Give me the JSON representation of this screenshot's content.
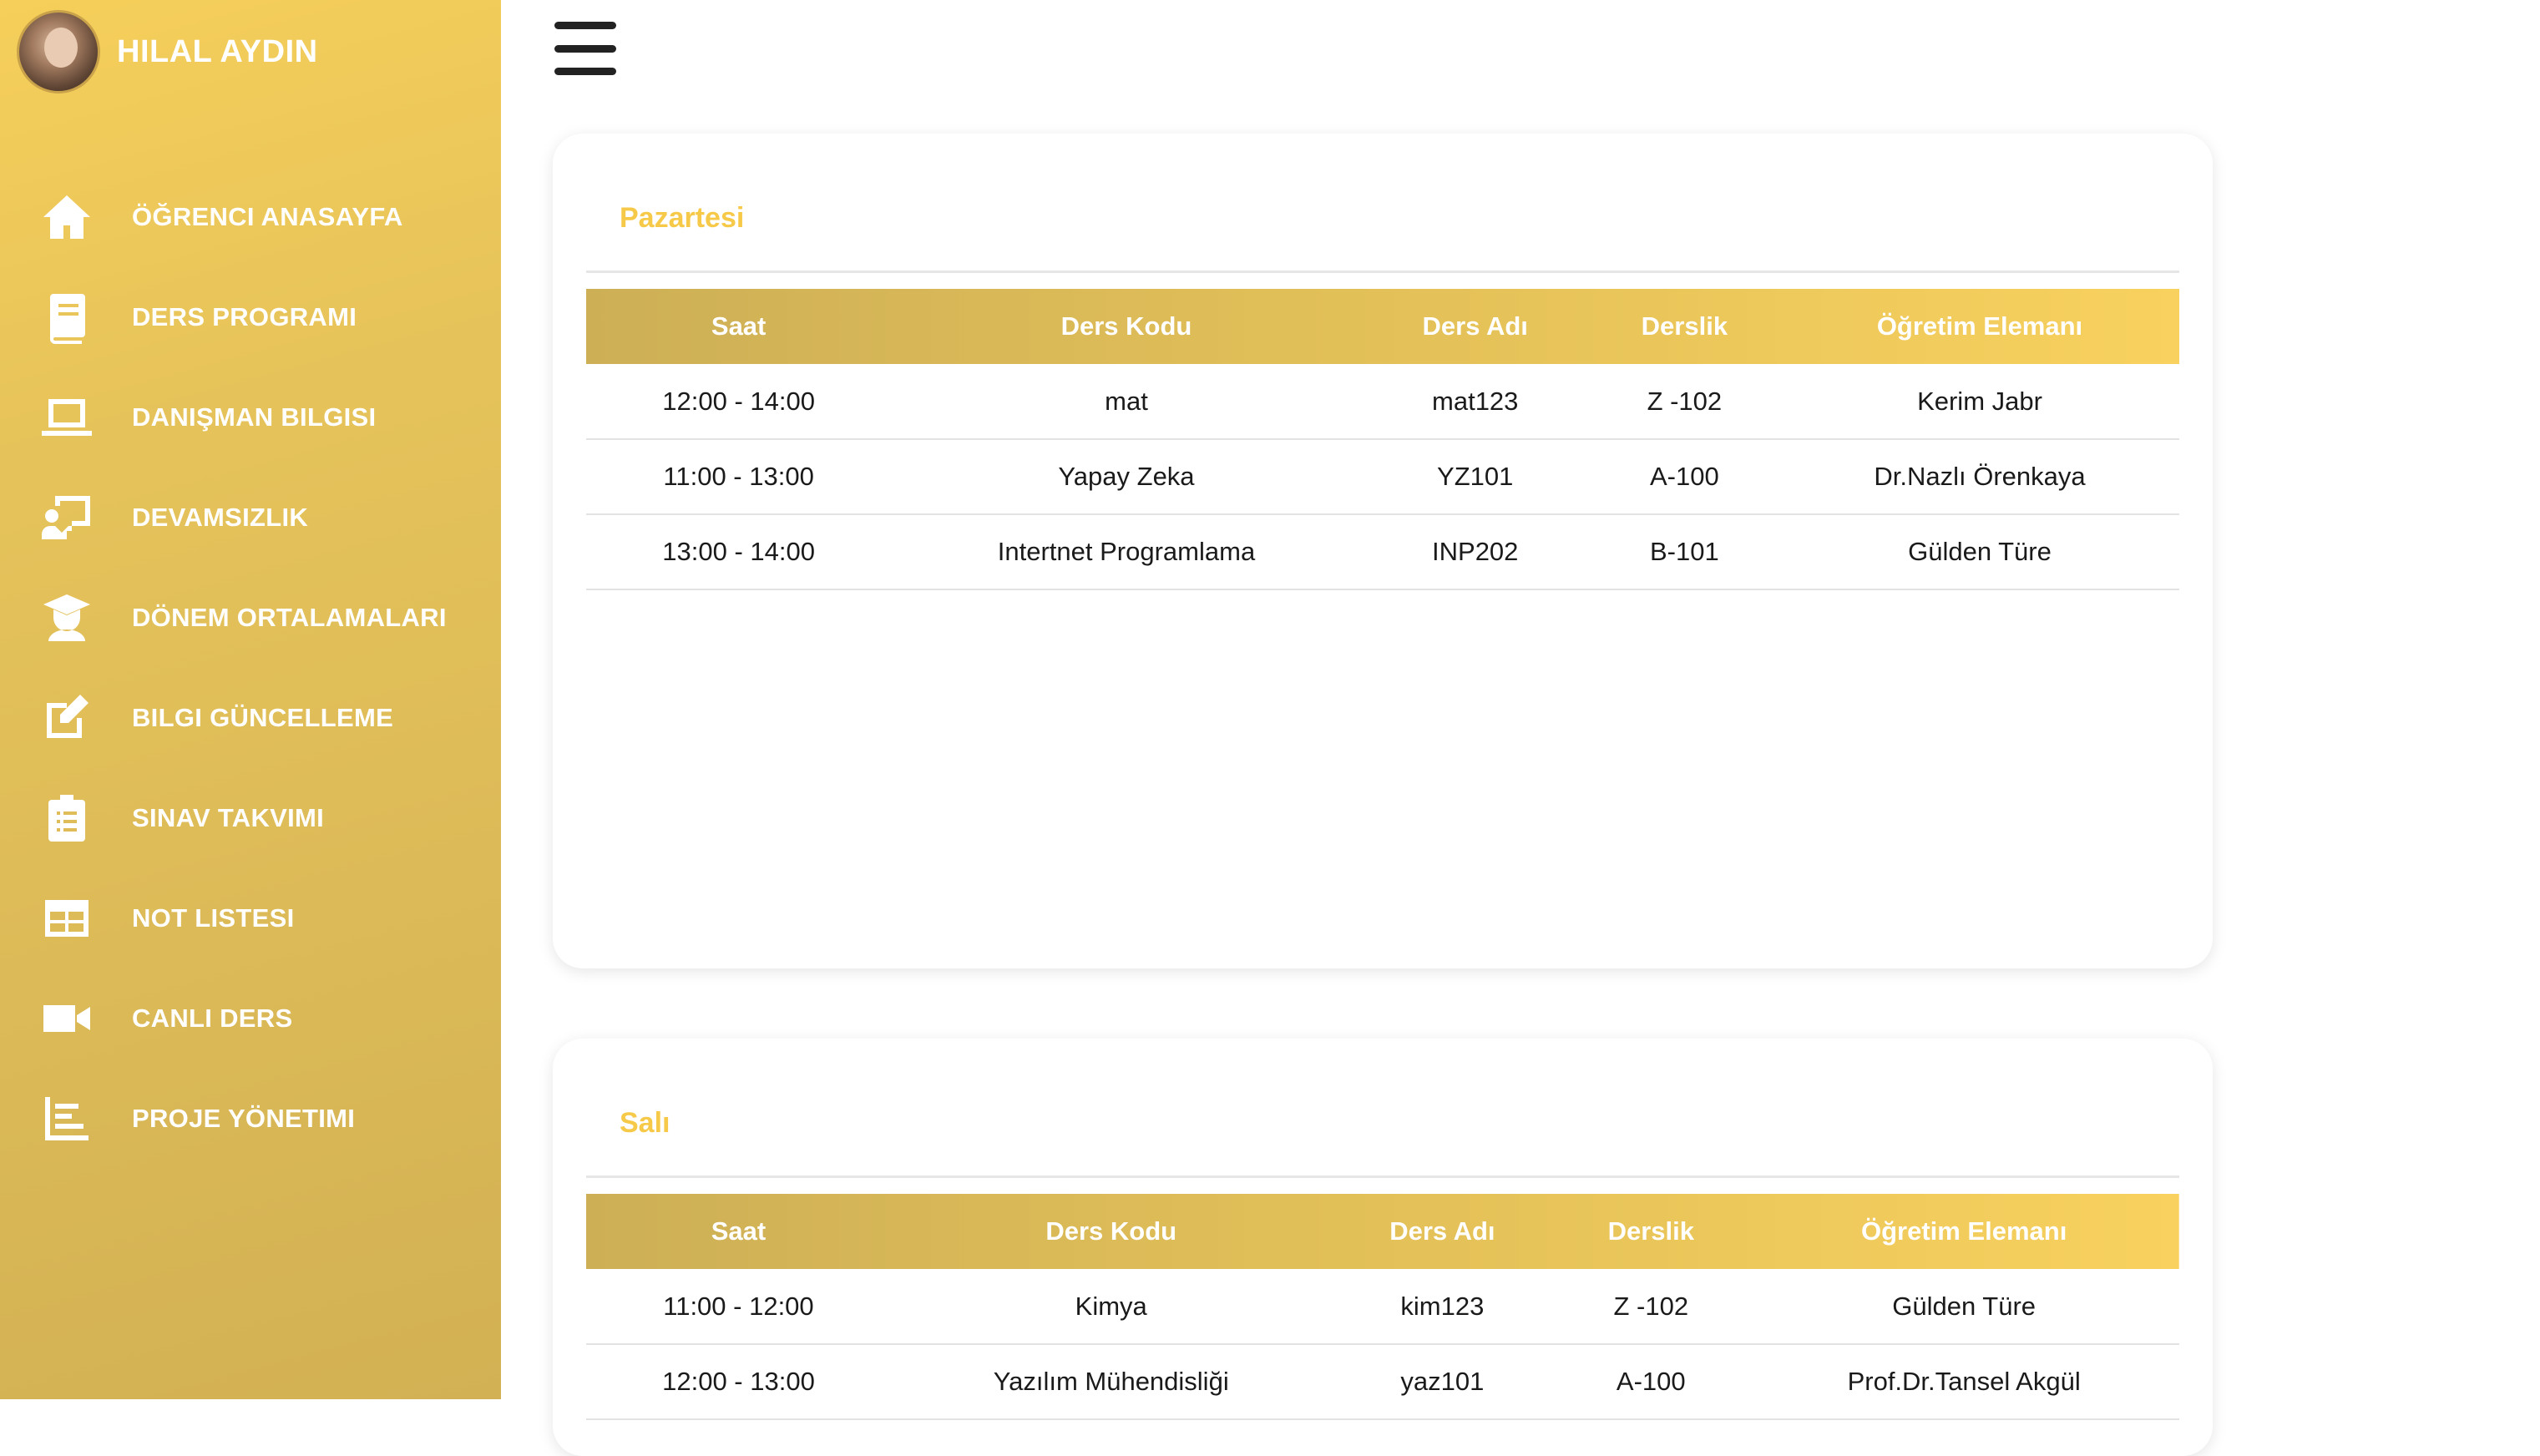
{
  "user": {
    "name": "HILAL AYDIN"
  },
  "nav": [
    {
      "label": "ÖĞRENCI ANASAYFA",
      "icon": "home-icon"
    },
    {
      "label": "DERS PROGRAMI",
      "icon": "book-icon"
    },
    {
      "label": "DANIŞMAN BILGISI",
      "icon": "laptop-icon"
    },
    {
      "label": "DEVAMSIZLIK",
      "icon": "teacher-icon"
    },
    {
      "label": "DÖNEM ORTALAMALARI",
      "icon": "graduate-icon"
    },
    {
      "label": "BILGI GÜNCELLEME",
      "icon": "edit-icon"
    },
    {
      "label": "SINAV TAKVIMI",
      "icon": "clipboard-list-icon"
    },
    {
      "label": "NOT LISTESI",
      "icon": "table-icon"
    },
    {
      "label": "CANLI DERS",
      "icon": "video-icon"
    },
    {
      "label": "PROJE YÖNETIMI",
      "icon": "chart-bar-icon"
    }
  ],
  "table_headers": [
    "Saat",
    "Ders Kodu",
    "Ders Adı",
    "Derslik",
    "Öğretim Elemanı"
  ],
  "days": [
    {
      "title": "Pazartesi",
      "rows": [
        [
          "12:00 - 14:00",
          "mat",
          "mat123",
          "Z -102",
          "Kerim Jabr"
        ],
        [
          "11:00 - 13:00",
          "Yapay Zeka",
          "YZ101",
          "A-100",
          "Dr.Nazlı Örenkaya"
        ],
        [
          "13:00 - 14:00",
          "Intertnet Programlama",
          "INP202",
          "B-101",
          "Gülden Türe"
        ]
      ]
    },
    {
      "title": "Salı",
      "rows": [
        [
          "11:00 - 12:00",
          "Kimya",
          "kim123",
          "Z -102",
          "Gülden Türe"
        ],
        [
          "12:00 - 13:00",
          "Yazılım Mühendisliği",
          "yaz101",
          "A-100",
          "Prof.Dr.Tansel Akgül"
        ]
      ]
    }
  ],
  "colors": {
    "accent": "#f7c948",
    "sidebar_top": "#f6cf5a",
    "sidebar_bottom": "#d2b154",
    "header_left": "#cdaf56",
    "header_right": "#f8d15e"
  }
}
